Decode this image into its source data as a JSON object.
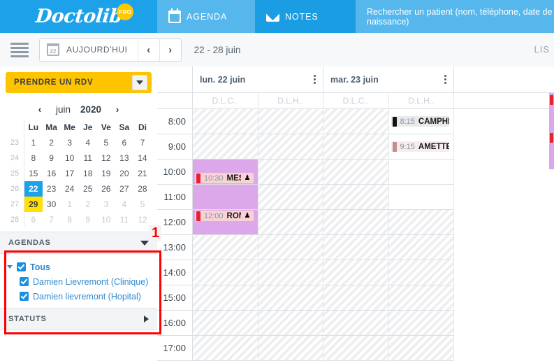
{
  "app": {
    "brand": "Doctolib",
    "brand_badge": "PRO",
    "brand_badge_color": "#ffc800",
    "accent_color": "#1da1e8"
  },
  "topbar": {
    "tabs": [
      {
        "label": "AGENDA",
        "icon": "calendar-icon",
        "active": true
      },
      {
        "label": "NOTES",
        "icon": "envelope-icon",
        "active": false
      }
    ],
    "search": {
      "placeholder": "Rechercher un patient (nom, téléphone, date de naissance)"
    }
  },
  "toolbar": {
    "menu_icon": "hamburger-icon",
    "today_label": "AUJOURD'HUI",
    "today_day_number": "22",
    "prev_label": "‹",
    "next_label": "›",
    "range_label": "22 - 28 juin",
    "view_toggle_label": "LIS"
  },
  "sidebar": {
    "rdv_button": {
      "label": "PRENDRE UN RDV",
      "color": "#ffc400"
    },
    "datepicker": {
      "prev_label": "‹",
      "next_label": "›",
      "month": "juin",
      "year": "2020",
      "weekday_headers": [
        "Lu",
        "Ma",
        "Me",
        "Je",
        "Ve",
        "Sa",
        "Di"
      ],
      "weeks": [
        {
          "wk": "23",
          "days": [
            {
              "d": "1",
              "state": "in"
            },
            {
              "d": "2",
              "state": "in"
            },
            {
              "d": "3",
              "state": "in"
            },
            {
              "d": "4",
              "state": "in"
            },
            {
              "d": "5",
              "state": "in"
            },
            {
              "d": "6",
              "state": "in"
            },
            {
              "d": "7",
              "state": "in"
            }
          ]
        },
        {
          "wk": "24",
          "days": [
            {
              "d": "8",
              "state": "in"
            },
            {
              "d": "9",
              "state": "in"
            },
            {
              "d": "10",
              "state": "in"
            },
            {
              "d": "11",
              "state": "in"
            },
            {
              "d": "12",
              "state": "in"
            },
            {
              "d": "13",
              "state": "in"
            },
            {
              "d": "14",
              "state": "in"
            }
          ]
        },
        {
          "wk": "25",
          "days": [
            {
              "d": "15",
              "state": "in"
            },
            {
              "d": "16",
              "state": "in"
            },
            {
              "d": "17",
              "state": "in"
            },
            {
              "d": "18",
              "state": "in"
            },
            {
              "d": "19",
              "state": "in"
            },
            {
              "d": "20",
              "state": "in"
            },
            {
              "d": "21",
              "state": "in"
            }
          ]
        },
        {
          "wk": "26",
          "days": [
            {
              "d": "22",
              "state": "selected"
            },
            {
              "d": "23",
              "state": "in"
            },
            {
              "d": "24",
              "state": "in"
            },
            {
              "d": "25",
              "state": "in"
            },
            {
              "d": "26",
              "state": "in"
            },
            {
              "d": "27",
              "state": "in"
            },
            {
              "d": "28",
              "state": "in"
            }
          ]
        },
        {
          "wk": "27",
          "days": [
            {
              "d": "29",
              "state": "today"
            },
            {
              "d": "30",
              "state": "in"
            },
            {
              "d": "1",
              "state": "out"
            },
            {
              "d": "2",
              "state": "out"
            },
            {
              "d": "3",
              "state": "out"
            },
            {
              "d": "4",
              "state": "out"
            },
            {
              "d": "5",
              "state": "out"
            }
          ]
        },
        {
          "wk": "28",
          "days": [
            {
              "d": "6",
              "state": "out"
            },
            {
              "d": "7",
              "state": "out"
            },
            {
              "d": "8",
              "state": "out"
            },
            {
              "d": "9",
              "state": "out"
            },
            {
              "d": "10",
              "state": "out"
            },
            {
              "d": "11",
              "state": "out"
            },
            {
              "d": "12",
              "state": "out"
            }
          ]
        }
      ]
    },
    "agendas_section": {
      "title": "AGENDAS",
      "expanded": true,
      "items": [
        {
          "label": "Tous",
          "checked": true,
          "level": 0
        },
        {
          "label": "Damien Lievremont (Clinique)",
          "checked": true,
          "level": 1
        },
        {
          "label": "Damien lievremont (Hopital)",
          "checked": true,
          "level": 1
        }
      ]
    },
    "statuts_section": {
      "title": "STATUTS",
      "expanded": false
    }
  },
  "calendar": {
    "day_columns": [
      {
        "label": "lun. 22 juin",
        "sub_columns": [
          "D.L.C..",
          "D.L.H.."
        ]
      },
      {
        "label": "mar. 23 juin",
        "sub_columns": [
          "D.L.C..",
          "D.L.H.."
        ]
      }
    ],
    "time_labels": [
      "8:00",
      "9:00",
      "10:00",
      "11:00",
      "12:00",
      "13:00",
      "14:00",
      "15:00",
      "16:00",
      "17:00"
    ],
    "appointments": [
      {
        "time": "10:30",
        "name": "MESSI",
        "day": "lun. 22 juin",
        "sub_column": "D.L.C..",
        "marker_color": "#e8212e",
        "bg_color": "#f9d2d6",
        "has_patient_icon": true
      },
      {
        "time": "12:00",
        "name": "RONADO",
        "day": "lun. 22 juin",
        "sub_column": "D.L.C..",
        "marker_color": "#e8212e",
        "bg_color": "#f9d2d6",
        "has_patient_icon": true
      },
      {
        "time": "8:15",
        "name": "CAMPHIN ...",
        "day": "mar. 23 juin",
        "sub_column": "D.L.H..",
        "marker_color": "#141414",
        "bg_color": "#e9e9eb",
        "has_patient_icon": false
      },
      {
        "time": "9:15",
        "name": "AMETTES",
        "day": "mar. 23 juin",
        "sub_column": "D.L.H..",
        "marker_color": "#c08f92",
        "bg_color": "#f6eced",
        "has_patient_icon": false
      }
    ],
    "busy_block_color": "#dda8ea",
    "unavailable_pattern": "diagonal-hatch"
  },
  "annotations": [
    {
      "number": "1",
      "color": "#ff0000",
      "target": "agendas-section"
    }
  ]
}
